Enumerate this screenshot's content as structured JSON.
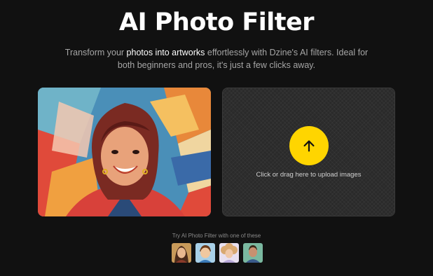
{
  "header": {
    "title": "AI Photo Filter",
    "subtitle_part1": "Transform your ",
    "subtitle_highlight": "photos into artworks",
    "subtitle_part2": " effortlessly with Dzine's AI filters. Ideal for both beginners and pros, it's just a few clicks away."
  },
  "upload": {
    "icon": "arrow-up-icon",
    "text": "Click or drag here to upload images"
  },
  "samples": {
    "label": "Try AI Photo Filter with one of these",
    "items": [
      {
        "name": "sample-woman-portrait"
      },
      {
        "name": "sample-cartoon-boy"
      },
      {
        "name": "sample-curly-girl"
      },
      {
        "name": "sample-man-portrait"
      }
    ]
  },
  "colors": {
    "background": "#111111",
    "accent": "#ffd500",
    "upload_panel": "#2a2a2a"
  }
}
